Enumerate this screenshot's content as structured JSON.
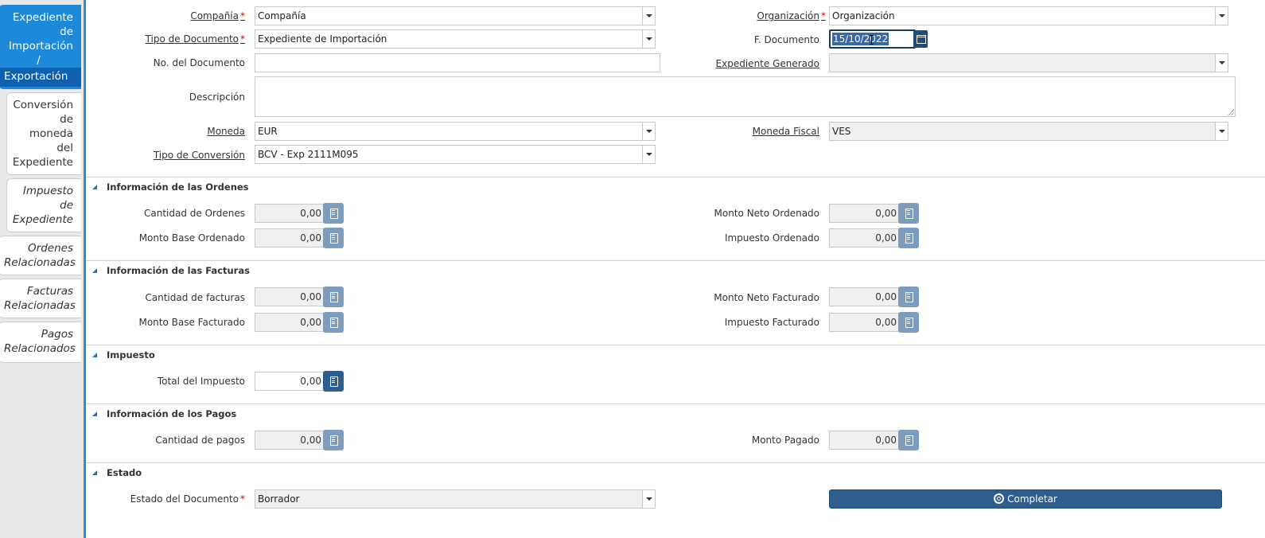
{
  "tabs": [
    {
      "label_lines": [
        "Expediente",
        "de",
        "Importación",
        "/"
      ],
      "last_line": "Exportación",
      "active": true
    },
    {
      "label_lines": [
        "Conversión",
        "de",
        "moneda",
        "del",
        "Expediente"
      ]
    },
    {
      "label_lines": [
        "Impuesto",
        "de",
        "Expediente"
      ]
    },
    {
      "label_lines": [
        "Ordenes",
        "Relacionadas"
      ]
    },
    {
      "label_lines": [
        "Facturas",
        "Relacionadas"
      ]
    },
    {
      "label_lines": [
        "Pagos",
        "Relacionados"
      ]
    }
  ],
  "header": {
    "compania": {
      "label": "Compañía",
      "value": "Compañía"
    },
    "organizacion": {
      "label": "Organización",
      "value": "Organización"
    },
    "tipo_documento": {
      "label": "Tipo de Documento",
      "value": "Expediente de Importación"
    },
    "f_documento": {
      "label": "F. Documento",
      "value": "15/10/2022"
    },
    "no_documento": {
      "label": "No. del Documento",
      "value": ""
    },
    "expediente_generado": {
      "label": "Expediente Generado",
      "value": ""
    },
    "descripcion": {
      "label": "Descripción",
      "value": ""
    },
    "moneda": {
      "label": "Moneda",
      "value": "EUR"
    },
    "moneda_fiscal": {
      "label": "Moneda Fiscal",
      "value": "VES"
    },
    "tipo_conversion": {
      "label": "Tipo de Conversión",
      "value": "BCV - Exp 2111M095"
    }
  },
  "sections": {
    "ordenes": {
      "title": "Información de las Ordenes",
      "cantidad": {
        "label": "Cantidad de Ordenes",
        "value": "0,00"
      },
      "monto_neto": {
        "label": "Monto Neto Ordenado",
        "value": "0,00"
      },
      "monto_base": {
        "label": "Monto Base Ordenado",
        "value": "0,00"
      },
      "impuesto": {
        "label": "Impuesto Ordenado",
        "value": "0,00"
      }
    },
    "facturas": {
      "title": "Información de las Facturas",
      "cantidad": {
        "label": "Cantidad de facturas",
        "value": "0,00"
      },
      "monto_neto": {
        "label": "Monto Neto Facturado",
        "value": "0,00"
      },
      "monto_base": {
        "label": "Monto Base Facturado",
        "value": "0,00"
      },
      "impuesto": {
        "label": "Impuesto Facturado",
        "value": "0,00"
      }
    },
    "impuesto": {
      "title": "Impuesto",
      "total": {
        "label": "Total del Impuesto",
        "value": "0,00"
      }
    },
    "pagos": {
      "title": "Información de los Pagos",
      "cantidad": {
        "label": "Cantidad de pagos",
        "value": "0,00"
      },
      "monto_pagado": {
        "label": "Monto Pagado",
        "value": "0,00"
      }
    },
    "estado": {
      "title": "Estado",
      "estado_documento": {
        "label": "Estado del Documento",
        "value": "Borrador"
      },
      "completar_label": "Completar"
    }
  },
  "colors": {
    "accent": "#1e88d9",
    "button": "#2d5e8e",
    "required": "#d40000"
  }
}
